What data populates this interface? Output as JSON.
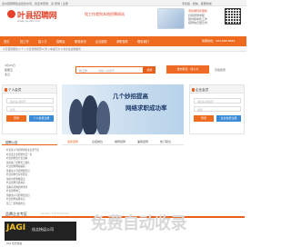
{
  "topbar": {
    "left_text": "汝州招聘网欢迎您的访问，您还未登录，请 登录 | 注册",
    "right_text": "手机版 · 微信 · 客服热线"
  },
  "header": {
    "logo_text": "叶县招聘网",
    "logo_sub": "www.ye-job.com",
    "slogan": "找工作就到本地招聘网站",
    "app_title": "手机端同步更新",
    "app_lines": [
      "扫码登录求职",
      "随时随地找工作",
      "招聘信息更及时"
    ]
  },
  "nav": {
    "items": [
      "首页",
      "找工作",
      "招人才",
      "招聘会",
      "职场资讯",
      "企业服务",
      "求职指导",
      "联系我们"
    ],
    "right": "客服热线：400-888-8888"
  },
  "subbar": {
    "text": "今日更新职位 0 个  |  今日新增简历 0 份  |  本站已为 0 家企业提供服务"
  },
  "weather": {
    "lines": [
      "4月25日",
      "星期五",
      "多云"
    ]
  },
  "search": {
    "select": "找工作",
    "placeholder": "请输入关键字",
    "button": "搜索",
    "hot": "发布职位 · 找人才",
    "hot_link": "高级搜索"
  },
  "member": {
    "title": "个人会员",
    "username": "用户名/手机号",
    "password": "密码",
    "login": "登录",
    "register": "个人免费注册"
  },
  "company": {
    "title": "企业会员",
    "username": "用户名/手机号",
    "password": "密码",
    "login": "登录",
    "register": "企业免费注册"
  },
  "banner": {
    "line1": "几个妙招提高",
    "line2": "网络求职成功率"
  },
  "tabs": [
    "最新招聘",
    "急招岗位",
    "推荐招聘",
    "兼职招聘",
    "热门职位"
  ],
  "news": {
    "title": "招聘公告",
    "items": [
      "叶县某公司招聘销售专员若干名",
      "叶县某企业招聘文员一名",
      "叶县招聘会计及出纳",
      "某机械厂招聘普工数名",
      "叶县招聘网站编辑",
      "某餐饮公司招聘服务员",
      "叶县招聘仓库管理员",
      "某超市招聘收银员",
      "叶县招聘司机两名",
      "某教育机构招聘老师",
      "叶县招聘电工",
      "某物流公司招聘配送员",
      "叶县招聘客服专员",
      "某工厂招聘质检员"
    ]
  },
  "companies": {
    "title": "品牌企业专区",
    "en": "BRAND ENTERPRISE",
    "logo_left": "JAGI",
    "logo_right": "佳吉快运公司",
    "caption": "JIAJI 佳吉快运"
  },
  "watermark": "免费自动收录"
}
